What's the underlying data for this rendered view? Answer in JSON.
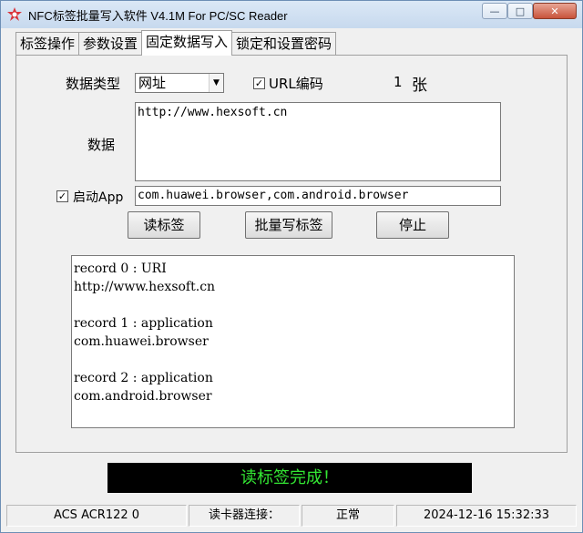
{
  "window": {
    "title": "NFC标签批量写入软件 V4.1M For PC/SC Reader",
    "controls": {
      "minimize": "—",
      "maximize": "□",
      "close": "✕"
    }
  },
  "tabs": [
    {
      "label": "标签操作",
      "active": false
    },
    {
      "label": "参数设置",
      "active": false
    },
    {
      "label": "固定数据写入",
      "active": true
    },
    {
      "label": "锁定和设置密码",
      "active": false
    }
  ],
  "form": {
    "data_type_label": "数据类型",
    "data_type_value": "网址",
    "url_encode_label": "URL编码",
    "url_encode_checked": true,
    "count_value": "1",
    "count_unit": "张",
    "data_label": "数据",
    "data_value": "http://www.hexsoft.cn",
    "start_app_label": "启动App",
    "start_app_checked": true,
    "app_value": "com.huawei.browser,com.android.browser"
  },
  "buttons": {
    "read": "读标签",
    "batch_write": "批量写标签",
    "stop": "停止"
  },
  "log": [
    "record 0 : URI",
    "http://www.hexsoft.cn",
    "",
    "record 1 : application",
    "com.huawei.browser",
    "",
    "record 2 : application",
    "com.android.browser"
  ],
  "status_message": "读标签完成！",
  "statusbar": {
    "reader": "ACS ACR122 0",
    "connection_label": "读卡器连接：",
    "connection_status": "正常",
    "datetime": "2024-12-16 15:32:33"
  },
  "colors": {
    "status_text": "#33e633",
    "status_background": "#000000",
    "app_icon": "#d9343b"
  },
  "icons": {
    "app": "nfc-app-icon",
    "dropdown": "chevron-down-icon",
    "checkbox": "checkmark-icon"
  }
}
